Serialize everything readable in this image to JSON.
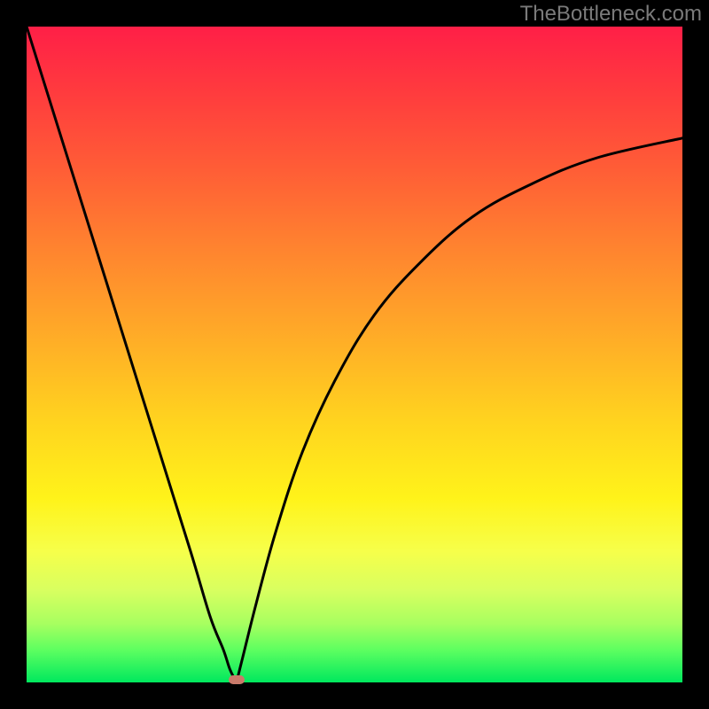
{
  "watermark": "TheBottleneck.com",
  "chart_data": {
    "type": "line",
    "title": "",
    "xlabel": "",
    "ylabel": "",
    "xlim": [
      0,
      100
    ],
    "ylim": [
      0,
      100
    ],
    "series": [
      {
        "name": "left-branch",
        "x": [
          0,
          5,
          10,
          15,
          20,
          25,
          28,
          30,
          31,
          32
        ],
        "y": [
          100,
          84,
          68,
          52,
          36,
          20,
          10,
          5,
          2,
          0
        ]
      },
      {
        "name": "right-branch",
        "x": [
          32,
          33,
          35,
          38,
          42,
          47,
          53,
          60,
          68,
          77,
          87,
          100
        ],
        "y": [
          0,
          4,
          12,
          23,
          35,
          46,
          56,
          64,
          71,
          76,
          80,
          83
        ]
      }
    ],
    "minimum_point": {
      "x": 32,
      "y": 0
    },
    "gradient_stops": [
      {
        "pct": 0,
        "color": "#ff1f47"
      },
      {
        "pct": 50,
        "color": "#ffb024"
      },
      {
        "pct": 75,
        "color": "#fff31a"
      },
      {
        "pct": 100,
        "color": "#00e85e"
      }
    ]
  }
}
